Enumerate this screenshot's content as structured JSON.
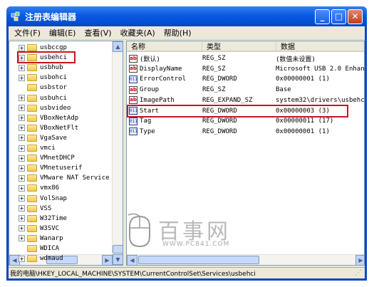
{
  "window": {
    "title": "注册表编辑器",
    "icon": "regedit-icon",
    "controls": {
      "minimize": "_",
      "maximize": "□",
      "close": "✕"
    }
  },
  "menu": [
    "文件(F)",
    "编辑(E)",
    "查看(V)",
    "收藏夹(A)",
    "帮助(H)"
  ],
  "tree": {
    "items": [
      {
        "label": "usbccgp",
        "expander": "+"
      },
      {
        "label": "usbehci",
        "expander": "+",
        "highlighted": true
      },
      {
        "label": "usbhub",
        "expander": "+"
      },
      {
        "label": "usbohci",
        "expander": "+"
      },
      {
        "label": "usbstor",
        "expander": ""
      },
      {
        "label": "usbuhci",
        "expander": "+"
      },
      {
        "label": "usbvideo",
        "expander": "+"
      },
      {
        "label": "VBoxNetAdp",
        "expander": "+"
      },
      {
        "label": "VBoxNetFlt",
        "expander": "+"
      },
      {
        "label": "VgaSave",
        "expander": "+"
      },
      {
        "label": "vmci",
        "expander": "+"
      },
      {
        "label": "VMnetDHCP",
        "expander": "+"
      },
      {
        "label": "VMnetuserif",
        "expander": "+"
      },
      {
        "label": "VMware NAT Service",
        "expander": "+"
      },
      {
        "label": "vmx86",
        "expander": "+"
      },
      {
        "label": "VolSnap",
        "expander": "+"
      },
      {
        "label": "VSS",
        "expander": "+"
      },
      {
        "label": "W32Time",
        "expander": "+"
      },
      {
        "label": "W3SVC",
        "expander": "+"
      },
      {
        "label": "Wanarp",
        "expander": "+"
      },
      {
        "label": "WDICA",
        "expander": ""
      },
      {
        "label": "wdmaud",
        "expander": "+"
      }
    ]
  },
  "list": {
    "columns": [
      "名称",
      "类型",
      "数据"
    ],
    "rows": [
      {
        "icon": "ab",
        "name": "(默认)",
        "type": "REG_SZ",
        "data": "(数值未设置)"
      },
      {
        "icon": "ab",
        "name": "DisplayName",
        "type": "REG_SZ",
        "data": "Microsoft USB 2.0 Enhan"
      },
      {
        "icon": "bin",
        "name": "ErrorControl",
        "type": "REG_DWORD",
        "data": "0x00000001 (1)"
      },
      {
        "icon": "ab",
        "name": "Group",
        "type": "REG_SZ",
        "data": "Base"
      },
      {
        "icon": "ab",
        "name": "ImagePath",
        "type": "REG_EXPAND_SZ",
        "data": "system32\\drivers\\usbehc"
      },
      {
        "icon": "bin",
        "name": "Start",
        "type": "REG_DWORD",
        "data": "0x00000003 (3)",
        "highlighted": true
      },
      {
        "icon": "bin",
        "name": "Tag",
        "type": "REG_DWORD",
        "data": "0x00000011 (17)"
      },
      {
        "icon": "bin",
        "name": "Type",
        "type": "REG_DWORD",
        "data": "0x00000001 (1)"
      }
    ]
  },
  "status": "我的电脑\\HKEY_LOCAL_MACHINE\\SYSTEM\\CurrentControlSet\\Services\\usbehci",
  "watermark": {
    "text": "百事网",
    "url": "WWW.PC841.COM"
  },
  "colors": {
    "highlight": "#c8141e",
    "title_blue": "#0a5ae2"
  }
}
